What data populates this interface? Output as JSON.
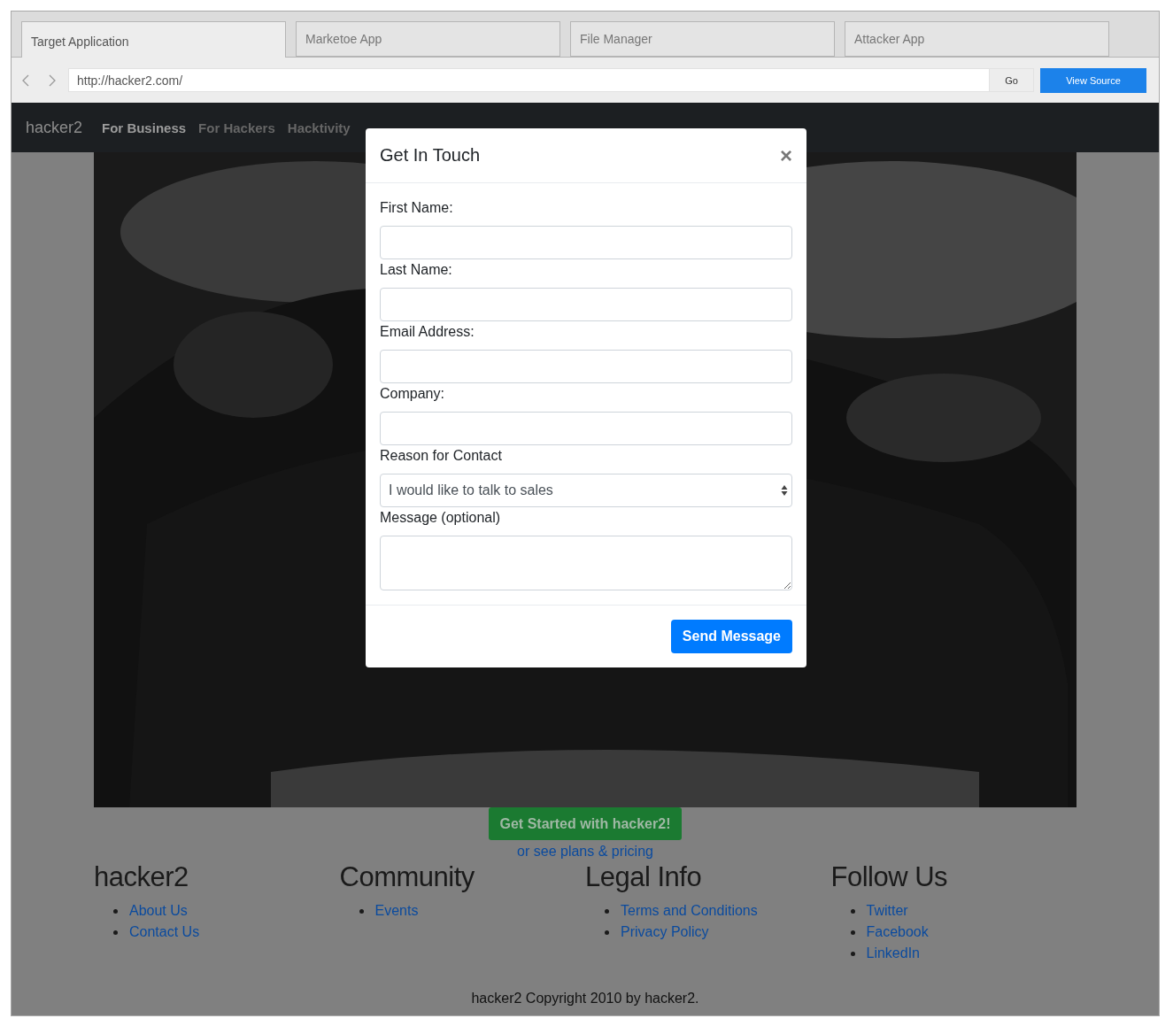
{
  "tabs": [
    {
      "label": "Target Application",
      "selected": true
    },
    {
      "label": "Marketoe App",
      "selected": false
    },
    {
      "label": "File Manager",
      "selected": false
    },
    {
      "label": "Attacker App",
      "selected": false
    }
  ],
  "address_bar": {
    "url": "http://hacker2.com/",
    "go_button": "Go",
    "view_source_button": "View Source"
  },
  "navbar": {
    "brand": "hacker2",
    "items": [
      {
        "label": "For Business",
        "selected": true
      },
      {
        "label": "For Hackers",
        "selected": false
      },
      {
        "label": "Hacktivity",
        "selected": false
      }
    ]
  },
  "cta": {
    "button": "Get Started with hacker2!",
    "link": "or see plans & pricing"
  },
  "footer": {
    "columns": [
      {
        "heading": "hacker2",
        "links": [
          "About Us",
          "Contact Us"
        ]
      },
      {
        "heading": "Community",
        "links": [
          "Events"
        ]
      },
      {
        "heading": "Legal Info",
        "links": [
          "Terms and Conditions",
          "Privacy Policy"
        ]
      },
      {
        "heading": "Follow Us",
        "links": [
          "Twitter",
          "Facebook",
          "LinkedIn"
        ]
      }
    ],
    "copyright": "hacker2 Copyright 2010 by hacker2."
  },
  "modal": {
    "title": "Get In Touch",
    "close": "×",
    "fields": [
      {
        "kind": "text",
        "label": "First Name:"
      },
      {
        "kind": "text",
        "label": "Last Name:"
      },
      {
        "kind": "text",
        "label": "Email Address:"
      },
      {
        "kind": "text",
        "label": "Company:"
      },
      {
        "kind": "select",
        "label": "Reason for Contact",
        "value": "I would like to talk to sales"
      },
      {
        "kind": "textarea",
        "label": "Message (optional)"
      }
    ],
    "submit": "Send Message"
  }
}
